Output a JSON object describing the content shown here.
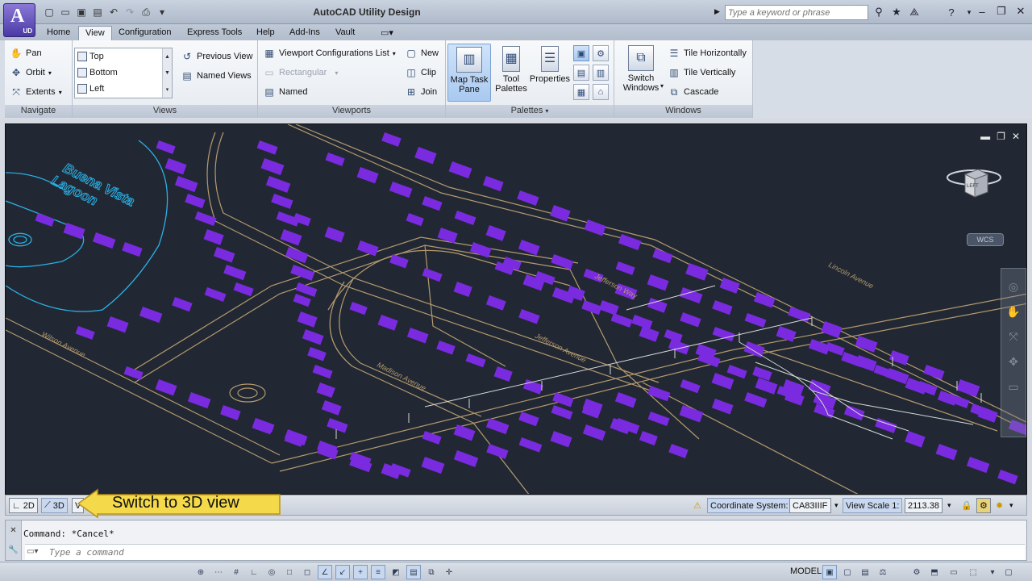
{
  "app": {
    "badge": "UD",
    "title": "AutoCAD Utility Design",
    "search_placeholder": "Type a keyword or phrase"
  },
  "tabs": [
    "Home",
    "View",
    "Configuration",
    "Express Tools",
    "Help",
    "Add-Ins",
    "Vault"
  ],
  "active_tab": "View",
  "ribbon": {
    "navigate": {
      "title": "Navigate",
      "pan": "Pan",
      "orbit": "Orbit",
      "extents": "Extents"
    },
    "views": {
      "title": "Views",
      "items": [
        "Top",
        "Bottom",
        "Left"
      ],
      "previous_view": "Previous View",
      "named_views": "Named Views"
    },
    "viewports": {
      "title": "Viewports",
      "config_list": "Viewport Configurations List",
      "rectangular": "Rectangular",
      "named": "Named",
      "new": "New",
      "clip": "Clip",
      "join": "Join"
    },
    "palettes": {
      "title": "Palettes",
      "map_task_pane": "Map Task Pane",
      "tool_palettes": "Tool Palettes",
      "properties": "Properties"
    },
    "windows": {
      "title": "Windows",
      "switch_windows": "Switch Windows",
      "tile_horizontally": "Tile Horizontally",
      "tile_vertically": "Tile Vertically",
      "cascade": "Cascade"
    }
  },
  "map": {
    "labels": {
      "lagoon": "Buena Vista Lagoon",
      "lincoln": "Lincoln Avenue",
      "jefferson_way": "Jefferson Way",
      "jefferson_ave": "Jefferson Avenue",
      "madison_ave": "Madison Avenue",
      "wilson_ave": "Wilson Avenue"
    },
    "colors": {
      "background": "#212833",
      "buildings": "#7a2be0",
      "roads": "#b59a6e",
      "water": "#2bb0e6",
      "utility": "#d8d8d8"
    },
    "viewcube_face": "LEFT",
    "wcs": "WCS"
  },
  "viewstatus": {
    "btn_2d": "2D",
    "btn_3d": "3D",
    "btn_v": "V",
    "coord_label": "Coordinate System:",
    "coord_value": "CA83IIIF",
    "scale_label": "View Scale 1:",
    "scale_value": "2113.38"
  },
  "callout": {
    "text": "Switch to 3D view"
  },
  "command": {
    "history": "Command: *Cancel*",
    "placeholder": "Type a command"
  },
  "statusbar": {
    "model": "MODEL"
  }
}
